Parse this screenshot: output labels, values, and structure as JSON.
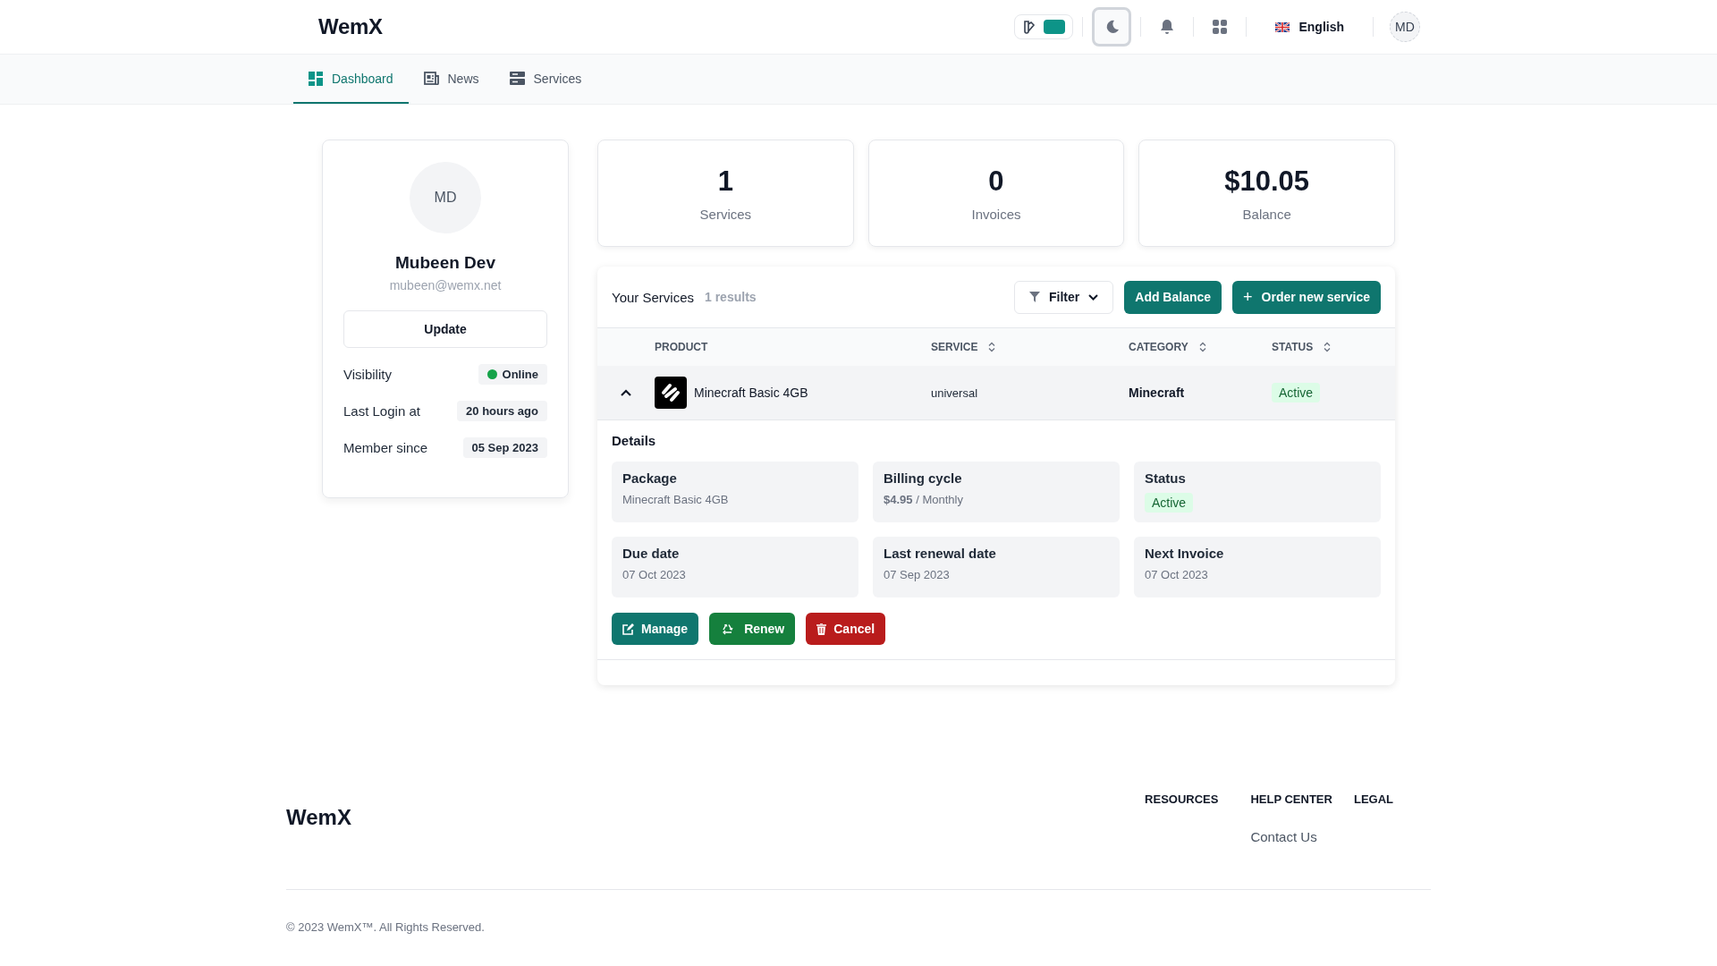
{
  "header": {
    "logo": "WemX",
    "language": "English",
    "avatar": "MD"
  },
  "theme_toggle": {
    "on": true
  },
  "tabs": [
    {
      "label": "Dashboard",
      "selected": true
    },
    {
      "label": "News",
      "selected": false
    },
    {
      "label": "Services",
      "selected": false
    }
  ],
  "profile": {
    "avatar": "MD",
    "name": "Mubeen Dev",
    "email": "mubeen@wemx.net",
    "button": "Update",
    "facts": [
      {
        "label": "Visibility",
        "value": "Online",
        "kind": "status",
        "color": "#16a34a"
      },
      {
        "label": "Last Login at",
        "value": "20 hours ago",
        "kind": "text"
      },
      {
        "label": "Member since",
        "value": "05 Sep 2023",
        "kind": "text"
      }
    ]
  },
  "stats": [
    {
      "value": "1",
      "label": "Services"
    },
    {
      "value": "0",
      "label": "Invoices"
    },
    {
      "value": "$10.05",
      "label": "Balance"
    }
  ],
  "services": {
    "title": "Your Services",
    "count": "1 results",
    "filter": "Filter",
    "add_balance": "Add Balance",
    "order": "+",
    "order_label": "Order new service",
    "columns": [
      {
        "label": "PRODUCT",
        "sortable": false
      },
      {
        "label": "SERVICE",
        "sortable": true
      },
      {
        "label": "CATEGORY",
        "sortable": true
      },
      {
        "label": "STATUS",
        "sortable": true
      }
    ],
    "rows": [
      {
        "expanded": true,
        "product": "Minecraft Basic 4GB",
        "service": "universal",
        "category": "Minecraft",
        "status": "Active",
        "details_title": "Details",
        "details": [
          {
            "label": "Package",
            "value": "Minecraft Basic 4GB",
            "kind": "text"
          },
          {
            "label": "Billing cycle",
            "value": "**$4.95** / Monthly",
            "kind": "text"
          },
          {
            "label": "Status",
            "value": "Active",
            "kind": "badge"
          },
          {
            "label": "Due date",
            "value": "07 Oct 2023",
            "kind": "text"
          },
          {
            "label": "Last renewal date",
            "value": "07 Sep 2023",
            "kind": "text"
          },
          {
            "label": "Next Invoice",
            "value": "07 Oct 2023",
            "kind": "text"
          }
        ],
        "actions": [
          {
            "label": "Manage",
            "kind": "manage"
          },
          {
            "label": "Renew",
            "kind": "renew"
          },
          {
            "label": "Cancel",
            "kind": "cancel"
          }
        ]
      }
    ]
  },
  "footer": {
    "logo": "WemX",
    "columns": [
      {
        "title": "RESOURCES"
      },
      {
        "title": "HELP CENTER",
        "links": [
          "Contact Us"
        ]
      },
      {
        "title": "LEGAL"
      }
    ],
    "copyright": "© 2023 WemX™. All Rights Reserved."
  }
}
